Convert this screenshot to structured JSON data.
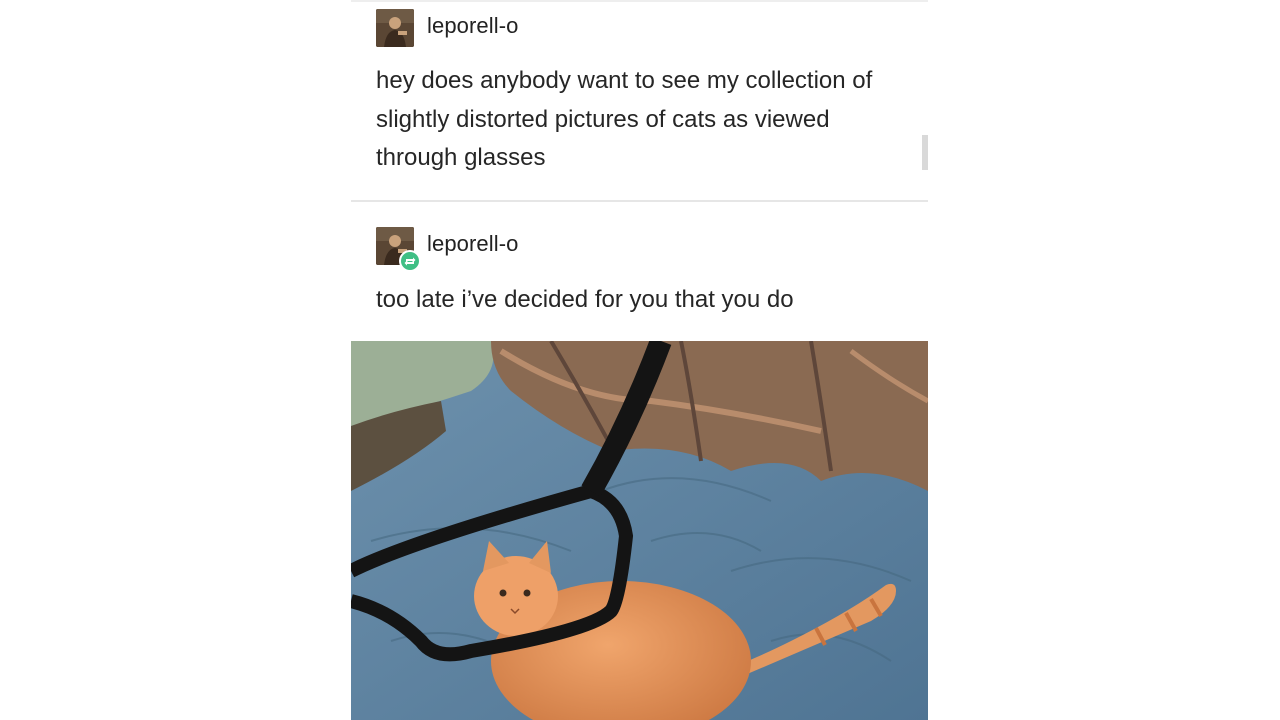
{
  "posts": [
    {
      "username": "leporell-o",
      "text": "hey does anybody want to see my collection of slightly distorted pictures of cats as viewed through glasses",
      "avatar_icon": "avatar-image",
      "reblogged": false
    },
    {
      "username": "leporell-o",
      "text": "too late i’ve decided for you that you do",
      "avatar_icon": "avatar-image",
      "reblogged": true,
      "badge_icon": "reblog-icon",
      "badge_color": "#3fbf85"
    }
  ],
  "photo": {
    "subject": "orange cat on blue blanket viewed through eyeglasses"
  },
  "colors": {
    "text": "#262626",
    "background": "#ffffff",
    "blanket": "#5a7f9e",
    "cat": "#e0915a"
  }
}
